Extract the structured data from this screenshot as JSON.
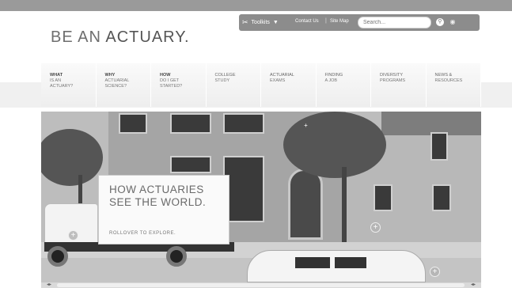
{
  "utility": {
    "toolkits_label": "Toolkits",
    "contact_label": "Contact Us",
    "sitemap_label": "Site Map",
    "separator": "|",
    "search_placeholder": "Search...",
    "search_button_icon": "search-icon",
    "rss_icon": "rss-icon"
  },
  "logo": {
    "part1": "BE AN ",
    "part2": "ACTUARY."
  },
  "nav": [
    {
      "line1": "WHAT",
      "line2": "IS AN",
      "line3": "ACTUARY?",
      "bold": true
    },
    {
      "line1": "WHY",
      "line2": "ACTUARIAL",
      "line3": "SCIENCE?",
      "bold": true
    },
    {
      "line1": "HOW",
      "line2": "DO I GET",
      "line3": "STARTED?",
      "bold": true
    },
    {
      "line1": "COLLEGE",
      "line2": "STUDY",
      "line3": "",
      "bold": false
    },
    {
      "line1": "ACTUARIAL",
      "line2": "EXAMS",
      "line3": "",
      "bold": false
    },
    {
      "line1": "FINDING",
      "line2": "A JOB",
      "line3": "",
      "bold": false
    },
    {
      "line1": "DIVERSITY",
      "line2": "PROGRAMS",
      "line3": "",
      "bold": false
    },
    {
      "line1": "NEWS &",
      "line2": "RESOURCES",
      "line3": "",
      "bold": false
    }
  ],
  "hero": {
    "title_line1": "HOW ACTUARIES",
    "title_line2": "SEE THE WORLD.",
    "subtitle": "ROLLOVER TO EXPLORE.",
    "hotspot_symbol": "+"
  },
  "scrollbar": {
    "left_arrow": "◂▸",
    "right_arrow": "◂▸"
  }
}
